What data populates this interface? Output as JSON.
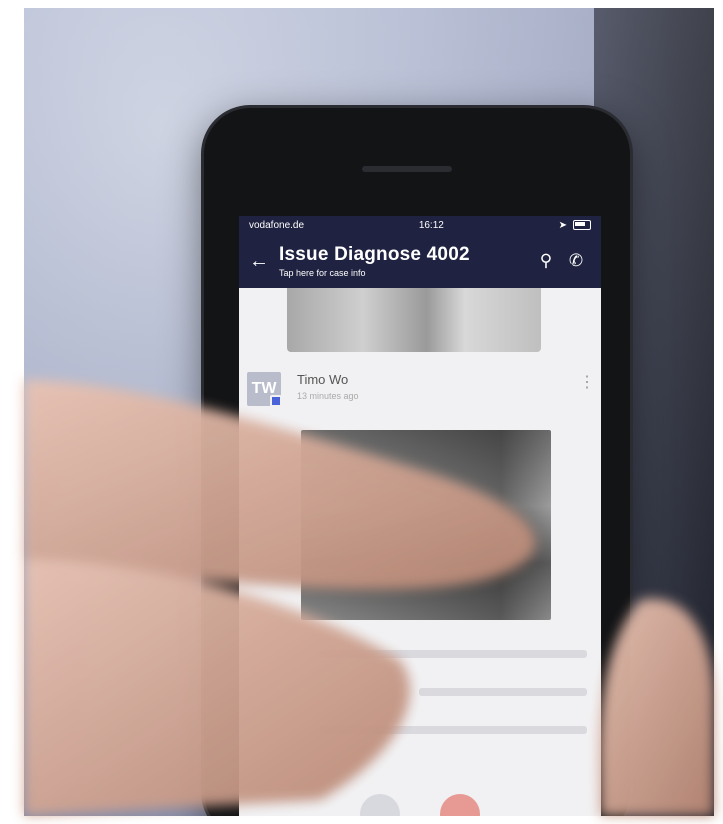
{
  "status": {
    "carrier": "vodafone.de",
    "time": "16:12"
  },
  "app": {
    "title": "Issue Diagnose 4002",
    "subtitle": "Tap here for case info"
  },
  "message": {
    "avatar_initials": "TW",
    "author": "Timo Wo",
    "time": "13 minutes ago"
  },
  "icons": {
    "back": "back-arrow-icon",
    "search": "search-icon",
    "call": "phone-icon",
    "more": "kebab-icon"
  },
  "colors": {
    "appbar": "#1f2240",
    "accent": "#4a63d8"
  }
}
